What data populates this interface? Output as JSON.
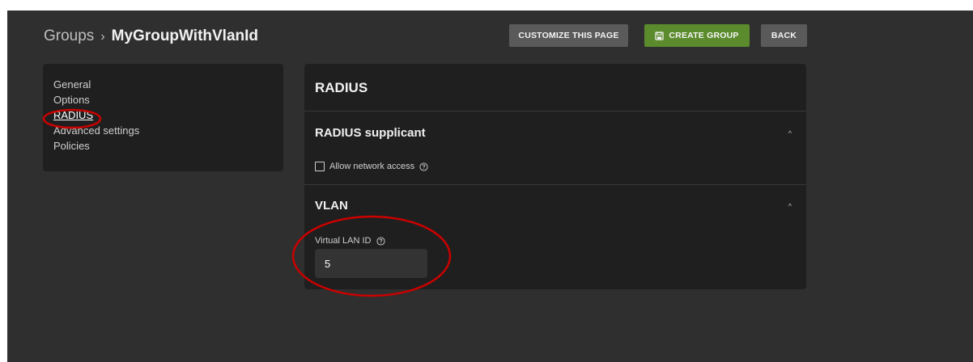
{
  "breadcrumb": {
    "root": "Groups",
    "separator": "›",
    "current": "MyGroupWithVlanId"
  },
  "toolbar": {
    "customize_label": "CUSTOMIZE THIS PAGE",
    "create_label": "CREATE GROUP",
    "back_label": "BACK"
  },
  "sidebar": {
    "items": [
      {
        "label": "General"
      },
      {
        "label": "Options"
      },
      {
        "label": "RADIUS"
      },
      {
        "label": "Advanced settings"
      },
      {
        "label": "Policies"
      }
    ],
    "active": "RADIUS"
  },
  "main": {
    "title": "RADIUS",
    "sections": [
      {
        "title": "RADIUS supplicant",
        "checkbox_label": "Allow network access",
        "checked": false
      },
      {
        "title": "VLAN",
        "field_label": "Virtual LAN ID",
        "field_value": "5"
      }
    ]
  },
  "colors": {
    "app_bg": "#2f2f2f",
    "panel_bg": "#1f1f1f",
    "primary_button": "#5b8b2c",
    "secondary_button": "#5a5a5a",
    "annotation": "#cc0000"
  },
  "icons": {
    "create_button": "save-icon",
    "help": "help-circle-icon",
    "collapse": "chevron-up-icon"
  }
}
